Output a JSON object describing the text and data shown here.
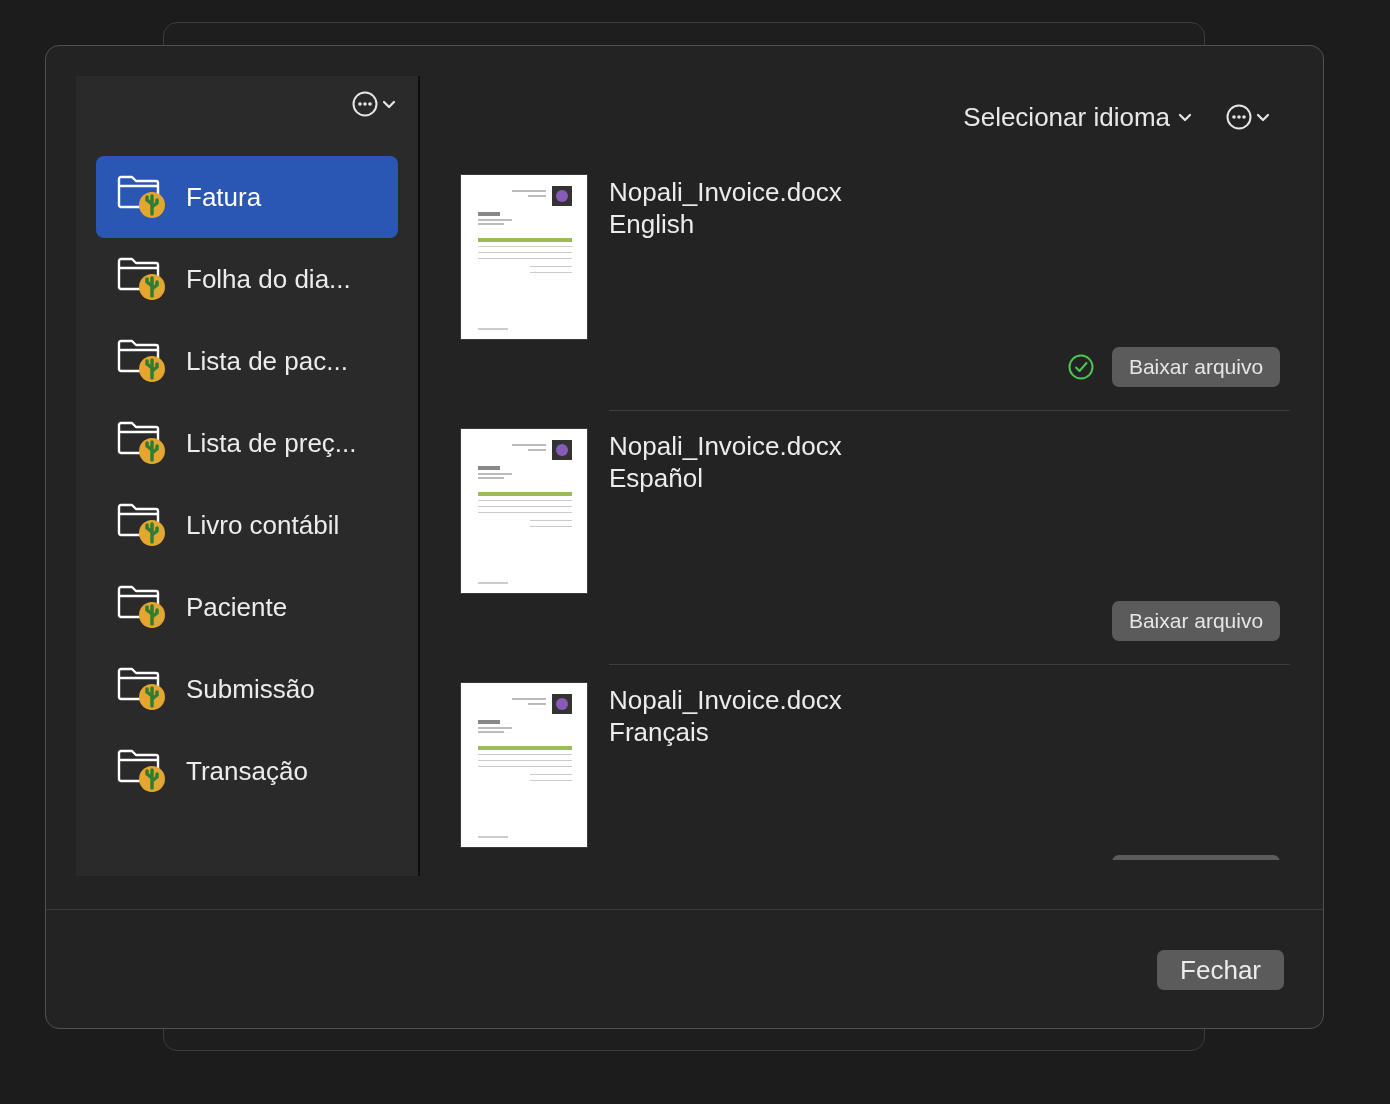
{
  "sidebar": {
    "items": [
      {
        "label": "Fatura",
        "selected": true
      },
      {
        "label": "Folha do dia...",
        "selected": false
      },
      {
        "label": "Lista de pac...",
        "selected": false
      },
      {
        "label": "Lista de preç...",
        "selected": false
      },
      {
        "label": "Livro contábil",
        "selected": false
      },
      {
        "label": "Paciente",
        "selected": false
      },
      {
        "label": "Submissão",
        "selected": false
      },
      {
        "label": "Transação",
        "selected": false
      }
    ]
  },
  "toolbar": {
    "language_menu": "Selecionar idioma"
  },
  "documents": [
    {
      "file": "Nopali_Invoice.docx",
      "language": "English",
      "downloaded": true,
      "button": "Baixar arquivo"
    },
    {
      "file": "Nopali_Invoice.docx",
      "language": "Español",
      "downloaded": false,
      "button": "Baixar arquivo"
    },
    {
      "file": "Nopali_Invoice.docx",
      "language": "Français"
    }
  ],
  "footer": {
    "close_button": "Fechar"
  }
}
